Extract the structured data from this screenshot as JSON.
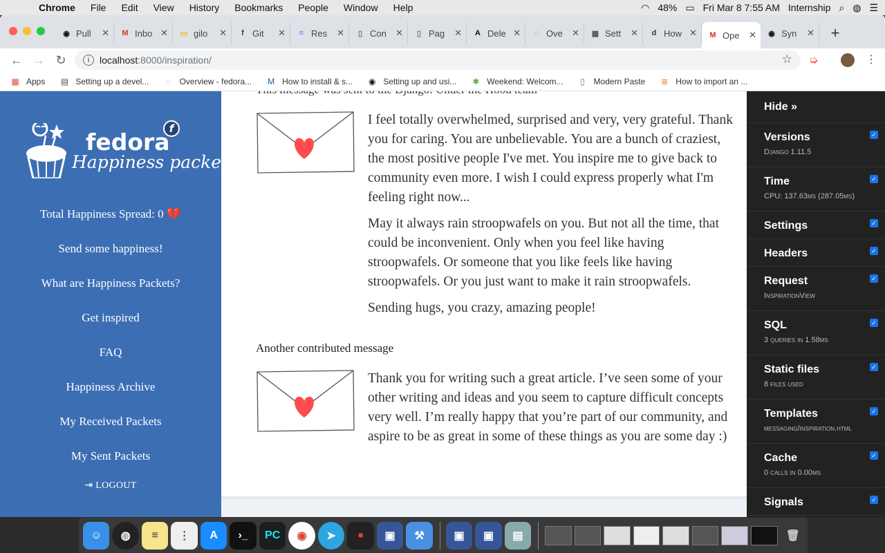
{
  "menubar": {
    "app": "Chrome",
    "menus": [
      "File",
      "Edit",
      "View",
      "History",
      "Bookmarks",
      "People",
      "Window",
      "Help"
    ],
    "battery": "48%",
    "datetime": "Fri Mar 8  7:55 AM",
    "wifi_user": "Internship"
  },
  "tabs": [
    {
      "title": "Pull",
      "icon": "github-icon",
      "icon_color": "#111",
      "glyph": "◉"
    },
    {
      "title": "Inbo",
      "icon": "gmail-icon",
      "icon_color": "#d93025",
      "glyph": "M"
    },
    {
      "title": "gilo",
      "icon": "slides-icon",
      "icon_color": "#f4b400",
      "glyph": "▭"
    },
    {
      "title": "Git",
      "icon": "fedora-icon",
      "icon_color": "#294172",
      "glyph": "f"
    },
    {
      "title": "Res",
      "icon": "docs-icon",
      "icon_color": "#4285f4",
      "glyph": "≡"
    },
    {
      "title": "Con",
      "icon": "page-icon",
      "icon_color": "#777",
      "glyph": "▯"
    },
    {
      "title": "Pag",
      "icon": "page-icon",
      "icon_color": "#777",
      "glyph": "▯"
    },
    {
      "title": "Dele",
      "icon": "font-icon",
      "icon_color": "#111",
      "glyph": "A"
    },
    {
      "title": "Ove",
      "icon": "ubuntu-icon",
      "icon_color": "#6a8fc8",
      "glyph": "◌"
    },
    {
      "title": "Sett",
      "icon": "settings-page-icon",
      "icon_color": "#555",
      "glyph": "▦"
    },
    {
      "title": "How",
      "icon": "django-icon",
      "icon_color": "#0c4b33",
      "glyph": "d"
    },
    {
      "title": "Ope",
      "icon": "gmail-icon",
      "icon_color": "#d93025",
      "glyph": "M"
    },
    {
      "title": "Syn",
      "icon": "github-icon",
      "icon_color": "#111",
      "glyph": "◉"
    }
  ],
  "address": {
    "host": "localhost",
    "path": ":8000/inspiration/"
  },
  "bookmarks": [
    {
      "label": "Apps",
      "icon": "apps-grid-icon"
    },
    {
      "label": "Setting up a devel...",
      "icon": "page-grid-icon"
    },
    {
      "label": "Overview - fedora...",
      "icon": "ubuntu-icon"
    },
    {
      "label": "How to install & s...",
      "icon": "m-logo-icon"
    },
    {
      "label": "Setting up and usi...",
      "icon": "github-icon"
    },
    {
      "label": "Weekend: Welcom...",
      "icon": "palm-icon"
    },
    {
      "label": "Modern Paste",
      "icon": "page-icon"
    },
    {
      "label": "How to import an ...",
      "icon": "stackoverflow-icon"
    }
  ],
  "sidebar": {
    "brand": "fedora",
    "subbrand": "Happiness packets",
    "total_spread": "Total Happiness Spread: 0",
    "heart": "💔",
    "items": [
      "Send some happiness!",
      "What are Happiness Packets?",
      "Get inspired",
      "FAQ",
      "Happiness Archive",
      "My Received Packets",
      "My Sent Packets"
    ],
    "logout": "LOGOUT"
  },
  "content": {
    "clipped_heading": "This message was sent to the Django: Under the Hood team",
    "message1": [
      "I feel totally overwhelmed, surprised and very, very grateful. Thank you for caring. You are unbelievable. You are a bunch of craziest, the most positive people I've met. You inspire me to give back to community even more. I wish I could express properly what I'm feeling right now...",
      "May it always rain stroopwafels on you. But not all the time, that could be inconvenient. Only when you feel like having stroopwafels. Or someone that you like feels like having stroopwafels. Or you just want to make it rain stroopwafels.",
      "Sending hugs, you crazy, amazing people!"
    ],
    "heading2": "Another contributed message",
    "message2": [
      "Thank you for writing such a great article. I’ve seen some of your other writing and ideas and you seem to capture difficult concepts very well. I’m really happy that you’re part of our community, and aspire to be as great in some of these things as you are some day :)"
    ]
  },
  "djdt": {
    "hide": "Hide »",
    "panels": [
      {
        "title": "Versions",
        "sub": "Django 1.11.5"
      },
      {
        "title": "Time",
        "sub": "CPU: 137.63ms (287.05ms)"
      },
      {
        "title": "Settings",
        "sub": ""
      },
      {
        "title": "Headers",
        "sub": ""
      },
      {
        "title": "Request",
        "sub": "InspirationView"
      },
      {
        "title": "SQL",
        "sub": "3 queries in 1.58ms"
      },
      {
        "title": "Static files",
        "sub": "8 files used"
      },
      {
        "title": "Templates",
        "sub": "messaging/inspiration.html"
      },
      {
        "title": "Cache",
        "sub": "0 calls in 0.00ms"
      },
      {
        "title": "Signals",
        "sub": ""
      }
    ]
  },
  "colors": {
    "sidebar_bg": "#3c6eb4",
    "djdt_bg": "#222222",
    "heart": "#ff4b4b"
  }
}
